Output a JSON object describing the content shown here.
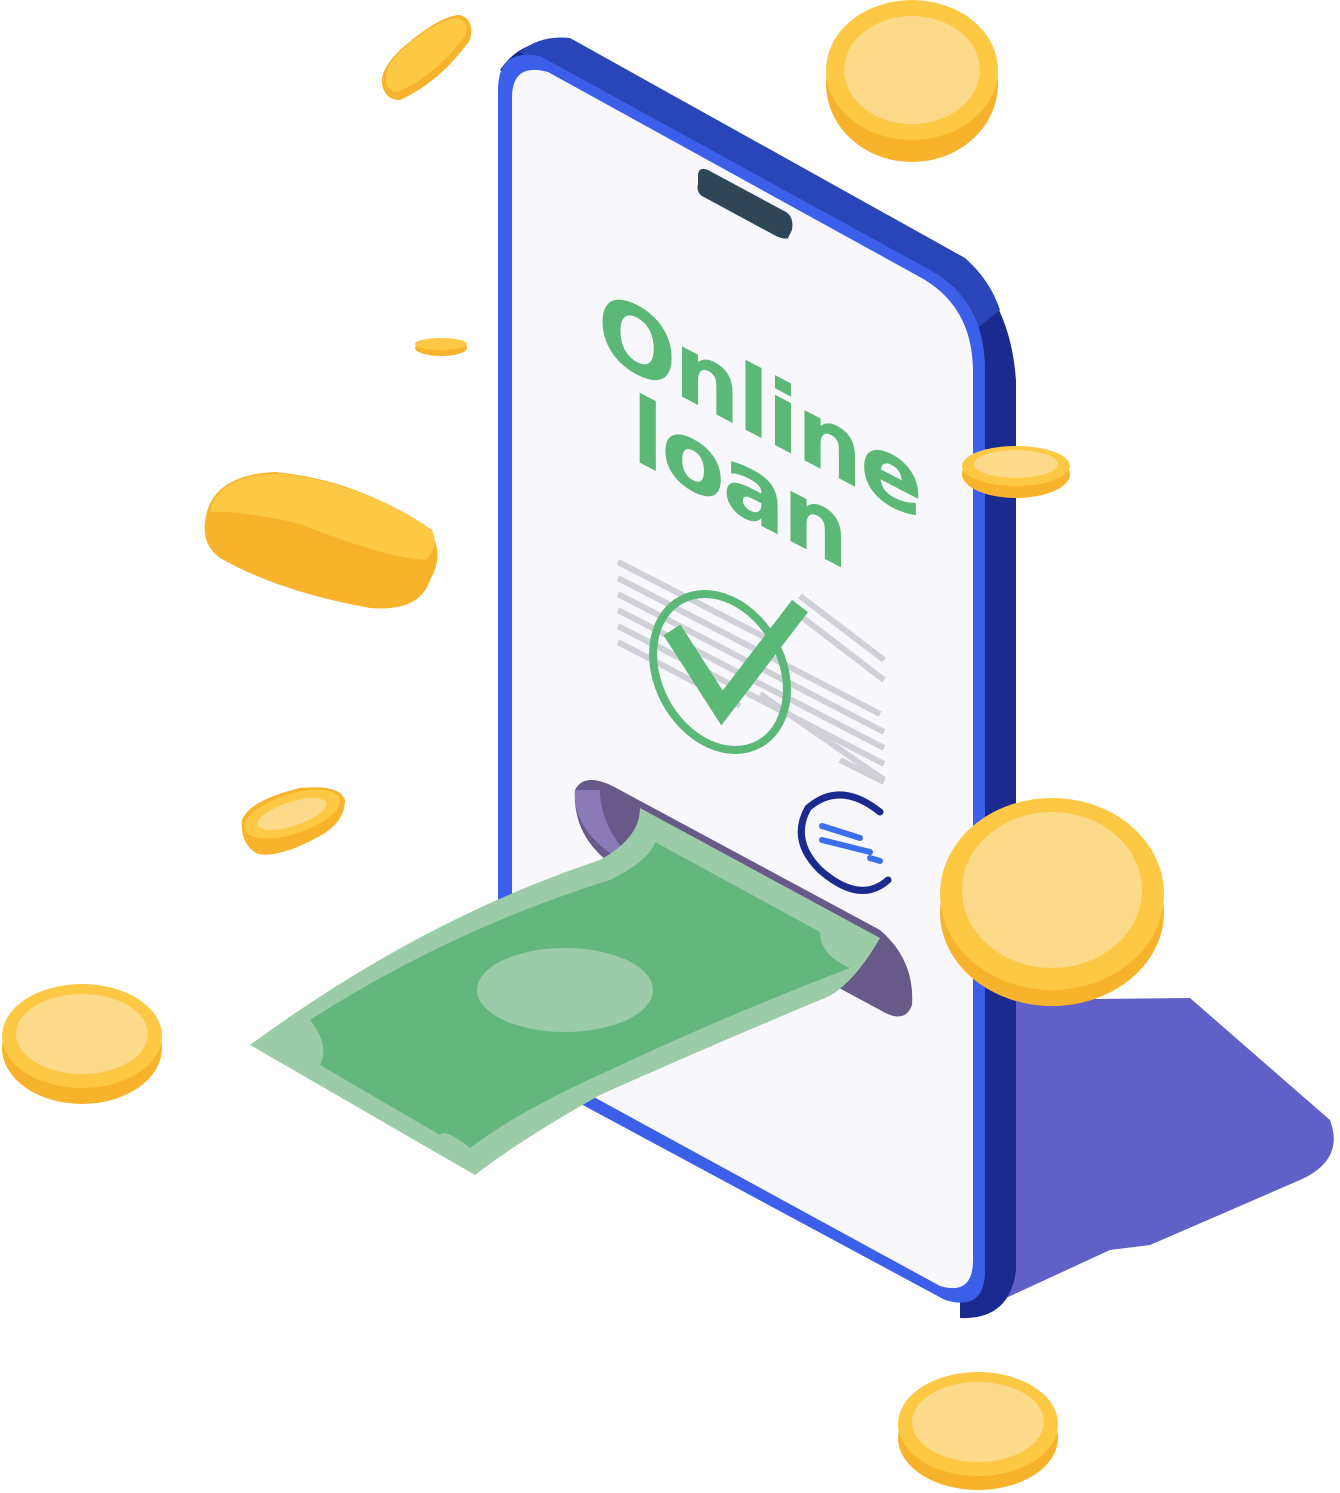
{
  "illustration": {
    "headline_line1": "Online",
    "headline_line2": "loan"
  },
  "icons": {
    "phone": "smartphone-icon",
    "check": "checkmark-icon",
    "logo": "brand-logo-icon",
    "banknote": "banknote-icon",
    "coin": "coin-icon"
  },
  "colors": {
    "phone_frame": "#3b5fe8",
    "phone_side": "#1a2a8e",
    "screen": "#f8f7fb",
    "headline": "#5bb877",
    "check": "#5bb877",
    "shadow": "#6060c8",
    "coin_face": "#fdd98a",
    "coin_edge": "#f7b32b",
    "banknote": "#63b77c",
    "banknote_light": "#9bcca7",
    "text_lines": "#cfd0d8"
  }
}
